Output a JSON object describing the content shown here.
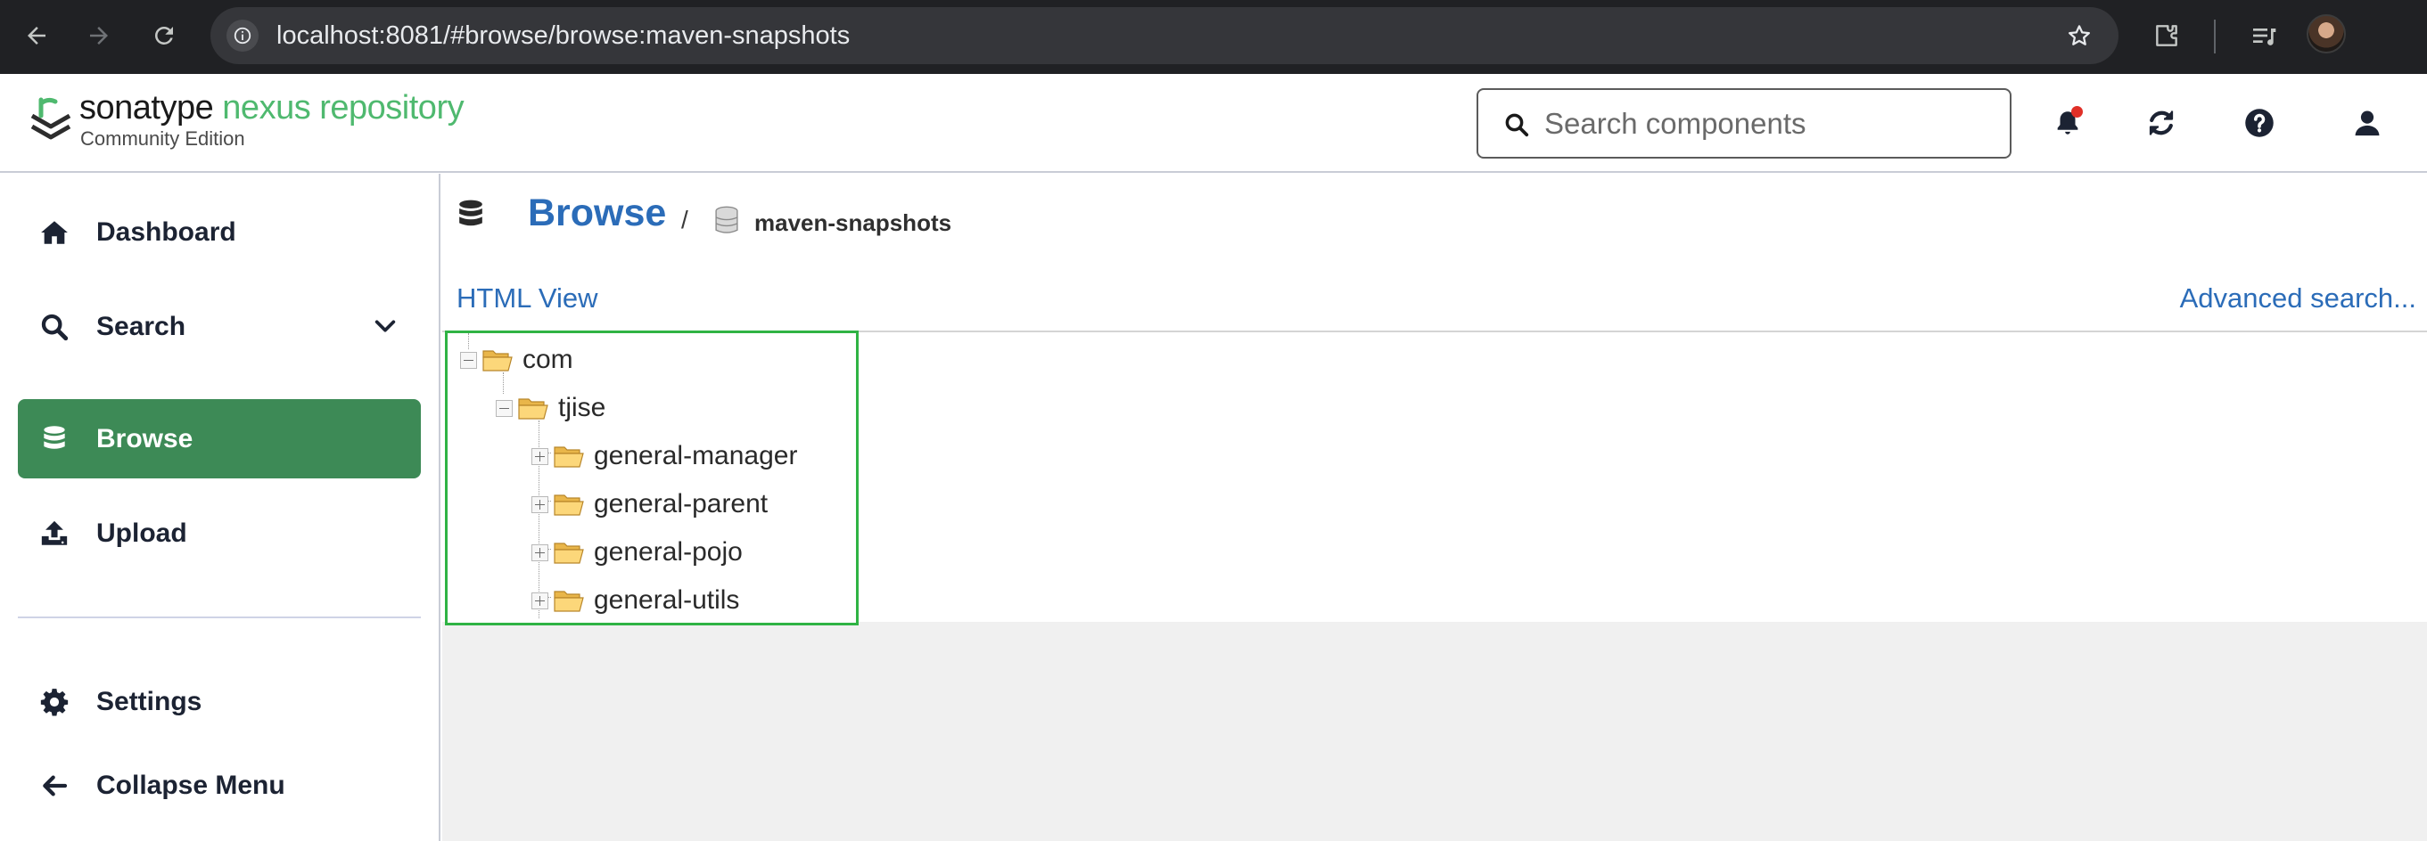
{
  "browser": {
    "url": "localhost:8081/#browse/browse:maven-snapshots",
    "icons": [
      "back-icon",
      "forward-icon",
      "reload-icon",
      "site-info-icon",
      "bookmark-star-icon",
      "extensions-icon",
      "reading-list-icon",
      "profile-avatar"
    ]
  },
  "header": {
    "brand_primary": "sonatype",
    "brand_secondary": "nexus repository",
    "edition": "Community Edition",
    "search_placeholder": "Search components",
    "colors": {
      "brand_green": "#4fb96f",
      "notification_dot": "#e02f27"
    }
  },
  "sidebar": {
    "items": [
      {
        "label": "Dashboard",
        "icon": "home-icon"
      },
      {
        "label": "Search",
        "icon": "search-icon",
        "expandable": true
      },
      {
        "label": "Browse",
        "icon": "database-icon",
        "active": true
      },
      {
        "label": "Upload",
        "icon": "upload-icon"
      },
      {
        "label": "Settings",
        "icon": "gear-icon"
      },
      {
        "label": "Collapse Menu",
        "icon": "arrow-left-icon"
      }
    ],
    "active_color": "#3d8a56"
  },
  "main": {
    "title": "Browse",
    "separator": "/",
    "repository": "maven-snapshots",
    "html_view_link": "HTML View",
    "advanced_search_link": "Advanced search...",
    "link_color": "#2b6cb8",
    "tree": [
      {
        "label": "com",
        "depth": 0,
        "expanded": true
      },
      {
        "label": "tjise",
        "depth": 1,
        "expanded": true
      },
      {
        "label": "general-manager",
        "depth": 2,
        "expanded": false
      },
      {
        "label": "general-parent",
        "depth": 2,
        "expanded": false
      },
      {
        "label": "general-pojo",
        "depth": 2,
        "expanded": false
      },
      {
        "label": "general-utils",
        "depth": 2,
        "expanded": false
      }
    ],
    "highlight_color": "#2fb344"
  }
}
